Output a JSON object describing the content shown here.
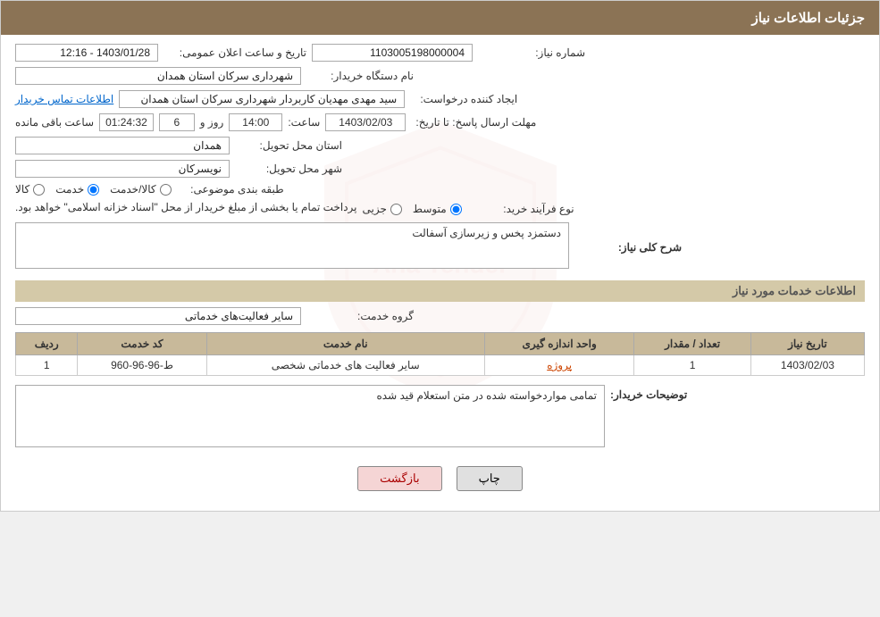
{
  "header": {
    "title": "جزئیات اطلاعات نیاز"
  },
  "fields": {
    "need_number_label": "شماره نیاز:",
    "need_number_value": "1103005198000004",
    "announce_datetime_label": "تاریخ و ساعت اعلان عمومی:",
    "announce_datetime_value": "1403/01/28 - 12:16",
    "buyer_name_label": "نام دستگاه خریدار:",
    "buyer_name_value": "شهرداری سرکان استان همدان",
    "creator_label": "ایجاد کننده درخواست:",
    "creator_value": "سید مهدی مهدیان کاربردار شهرداری سرکان استان همدان",
    "contact_link": "اطلاعات تماس خریدار",
    "send_deadline_label": "مهلت ارسال پاسخ: تا تاریخ:",
    "send_date_value": "1403/02/03",
    "send_time_label": "ساعت:",
    "send_time_value": "14:00",
    "send_days_label": "روز و",
    "send_days_value": "6",
    "remaining_label": "ساعت باقی مانده",
    "remaining_value": "01:24:32",
    "province_label": "استان محل تحویل:",
    "province_value": "همدان",
    "city_label": "شهر محل تحویل:",
    "city_value": "نویسرکان",
    "category_label": "طبقه بندی موضوعی:",
    "category_options": [
      "کالا",
      "خدمت",
      "کالا/خدمت"
    ],
    "category_selected": "خدمت",
    "process_label": "نوع فرآیند خرید:",
    "process_options": [
      "جزیی",
      "متوسط"
    ],
    "process_selected": "متوسط",
    "process_note": "پرداخت تمام یا بخشی از مبلغ خریدار از محل \"اسناد خزانه اسلامی\" خواهد بود.",
    "need_desc_label": "شرح کلی نیاز:",
    "need_desc_value": "دستمزد پخس و زیرسازی آسفالت",
    "services_section_title": "اطلاعات خدمات مورد نیاز",
    "service_group_label": "گروه خدمت:",
    "service_group_value": "سایر فعالیت‌های خدماتی",
    "table": {
      "headers": [
        "ردیف",
        "کد خدمت",
        "نام خدمت",
        "واحد اندازه گیری",
        "تعداد / مقدار",
        "تاریخ نیاز"
      ],
      "rows": [
        {
          "row": "1",
          "code": "ط-96-96-960",
          "name": "سایر فعالیت های خدماتی شخصی",
          "unit": "پروژه",
          "count": "1",
          "date": "1403/02/03"
        }
      ]
    },
    "buyer_notes_label": "توضیحات خریدار:",
    "buyer_notes_value": "تمامی مواردخواسته شده در متن استعلام قید شده"
  },
  "buttons": {
    "print": "چاپ",
    "back": "بازگشت"
  }
}
